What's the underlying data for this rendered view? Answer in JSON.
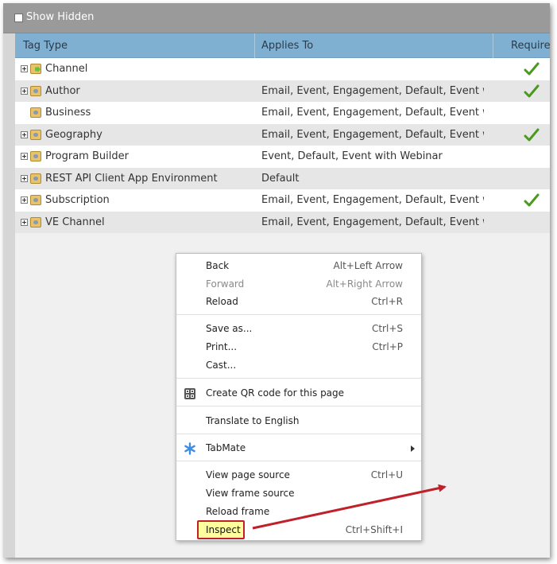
{
  "toolbar": {
    "show_hidden_label": "Show Hidden"
  },
  "grid": {
    "columns": [
      "Tag Type",
      "Applies To",
      "Require"
    ],
    "rows": [
      {
        "name": "Channel",
        "applies": "",
        "required": true,
        "expandable": true,
        "icon": "channel-tag-icon"
      },
      {
        "name": "Author",
        "applies": "Email, Event, Engagement, Default, Event wit...",
        "required": true,
        "expandable": true,
        "icon": "tag-icon"
      },
      {
        "name": "Business",
        "applies": "Email, Event, Engagement, Default, Event wit...",
        "required": false,
        "expandable": false,
        "icon": "tag-icon"
      },
      {
        "name": "Geography",
        "applies": "Email, Event, Engagement, Default, Event wit...",
        "required": true,
        "expandable": true,
        "icon": "tag-icon"
      },
      {
        "name": "Program Builder",
        "applies": "Event, Default, Event with Webinar",
        "required": false,
        "expandable": true,
        "icon": "tag-icon"
      },
      {
        "name": "REST API Client App Environment",
        "applies": "Default",
        "required": false,
        "expandable": true,
        "icon": "tag-icon"
      },
      {
        "name": "Subscription",
        "applies": "Email, Event, Engagement, Default, Event wit...",
        "required": true,
        "expandable": true,
        "icon": "tag-icon"
      },
      {
        "name": "VE Channel",
        "applies": "Email, Event, Engagement, Default, Event wit...",
        "required": false,
        "expandable": true,
        "icon": "tag-icon"
      }
    ]
  },
  "context_menu": {
    "back": {
      "label": "Back",
      "shortcut": "Alt+Left Arrow"
    },
    "forward": {
      "label": "Forward",
      "shortcut": "Alt+Right Arrow"
    },
    "reload": {
      "label": "Reload",
      "shortcut": "Ctrl+R"
    },
    "save_as": {
      "label": "Save as...",
      "shortcut": "Ctrl+S"
    },
    "print": {
      "label": "Print...",
      "shortcut": "Ctrl+P"
    },
    "cast": {
      "label": "Cast..."
    },
    "qr": {
      "label": "Create QR code for this page"
    },
    "translate": {
      "label": "Translate to English"
    },
    "tabmate": {
      "label": "TabMate"
    },
    "view_source": {
      "label": "View page source",
      "shortcut": "Ctrl+U"
    },
    "view_frame_source": {
      "label": "View frame source"
    },
    "reload_frame": {
      "label": "Reload frame"
    },
    "inspect": {
      "label": "Inspect",
      "shortcut": "Ctrl+Shift+I"
    }
  },
  "colors": {
    "toolbar_bg": "#9a9a9a",
    "header_bg": "#7fb0d2",
    "check_green": "#4a9a1e",
    "annotation_red": "#c0202a",
    "highlight_yellow": "#fefe9e"
  }
}
